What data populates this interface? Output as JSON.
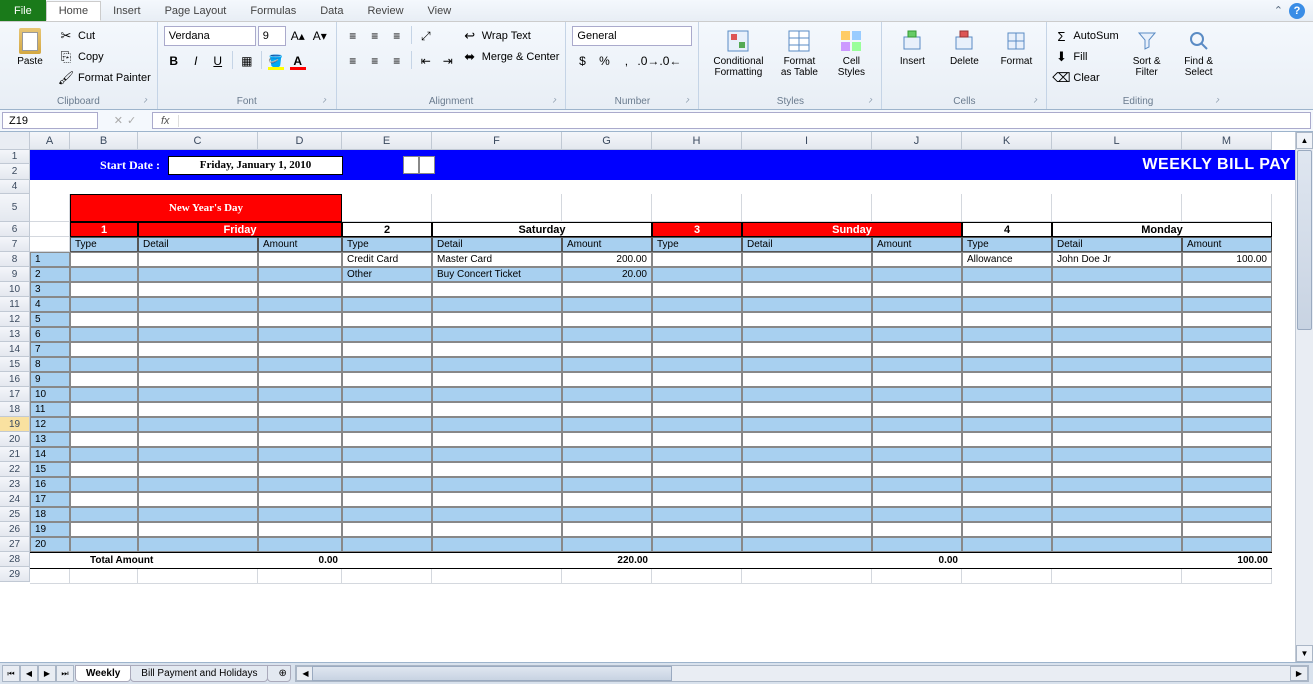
{
  "tabs": {
    "file": "File",
    "home": "Home",
    "insert": "Insert",
    "pageLayout": "Page Layout",
    "formulas": "Formulas",
    "data": "Data",
    "review": "Review",
    "view": "View"
  },
  "clipboard": {
    "paste": "Paste",
    "cut": "Cut",
    "copy": "Copy",
    "formatPainter": "Format Painter",
    "label": "Clipboard"
  },
  "font": {
    "name": "Verdana",
    "size": "9",
    "label": "Font"
  },
  "alignment": {
    "wrap": "Wrap Text",
    "merge": "Merge & Center",
    "label": "Alignment"
  },
  "number": {
    "format": "General",
    "label": "Number"
  },
  "styles": {
    "conditional": "Conditional Formatting",
    "formatTable": "Format as Table",
    "cellStyles": "Cell Styles",
    "label": "Styles"
  },
  "cellsGroup": {
    "insert": "Insert",
    "delete": "Delete",
    "format": "Format",
    "label": "Cells"
  },
  "editing": {
    "autosum": "AutoSum",
    "fill": "Fill",
    "clear": "Clear",
    "sort": "Sort & Filter",
    "find": "Find & Select",
    "label": "Editing"
  },
  "nameBox": "Z19",
  "banner": {
    "startLabel": "Start Date :",
    "startDate": "Friday, January 1, 2010",
    "title": "WEEKLY BILL PAY"
  },
  "holiday": "New Year's Day",
  "days": [
    {
      "num": "1",
      "name": "Friday",
      "red": true
    },
    {
      "num": "2",
      "name": "Saturday",
      "red": false
    },
    {
      "num": "3",
      "name": "Sunday",
      "red": true
    },
    {
      "num": "4",
      "name": "Monday",
      "red": false
    }
  ],
  "subHeaders": [
    "Type",
    "Detail",
    "Amount"
  ],
  "rowNums": [
    "1",
    "2",
    "3",
    "4",
    "5",
    "6",
    "7",
    "8",
    "9",
    "10",
    "11",
    "12",
    "13",
    "14",
    "15",
    "16",
    "17",
    "18",
    "19",
    "20"
  ],
  "dataRows": [
    {
      "d2": {
        "type": "Credit Card",
        "detail": "Master Card",
        "amount": "200.00"
      },
      "d4": {
        "type": "Allowance",
        "detail": "John Doe Jr",
        "amount": "100.00"
      }
    },
    {
      "d2": {
        "type": "Other",
        "detail": "Buy Concert Ticket",
        "amount": "20.00"
      }
    }
  ],
  "totals": {
    "label": "Total Amount",
    "d1": "0.00",
    "d2": "220.00",
    "d3": "0.00",
    "d4": "100.00"
  },
  "cols": [
    "A",
    "B",
    "C",
    "D",
    "E",
    "F",
    "G",
    "H",
    "I",
    "J",
    "K",
    "L",
    "M"
  ],
  "excelRows": [
    "1",
    "2",
    "4",
    "5",
    "6",
    "7",
    "8",
    "9",
    "10",
    "11",
    "12",
    "13",
    "14",
    "15",
    "16",
    "17",
    "18",
    "19",
    "20",
    "21",
    "22",
    "23",
    "24",
    "25",
    "26",
    "27",
    "28",
    "29"
  ],
  "sheets": {
    "s1": "Weekly",
    "s2": "Bill Payment and Holidays"
  }
}
